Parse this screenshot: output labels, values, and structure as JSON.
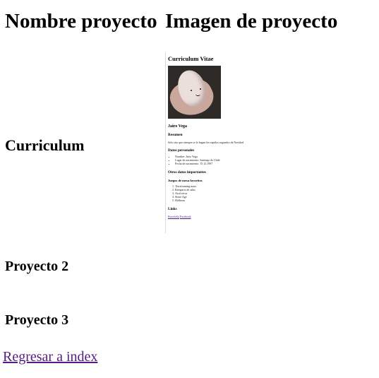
{
  "header": {
    "col_name": "Nombre proyecto",
    "col_image": "Imagen de proyecto"
  },
  "rows": [
    {
      "title": "Curriculum"
    },
    {
      "title": "Proyecto 2"
    },
    {
      "title": "Proyecto 3"
    }
  ],
  "cv_preview": {
    "title": "Curriculum Vitae",
    "name": "Jairo Vega",
    "summary_heading": "Resumen",
    "summary_text": "Solo sito que siempre se le hagan los rapidos segundos de Navidad y comas tantas, todo de abrazo.",
    "personal_heading": "Datos personales",
    "personal_items": [
      "Nombre: Jairo Vega",
      "Lugar de nacimiento: Santiago de Chile",
      "Fecha de nacimiento: 15.12.1997"
    ],
    "other_heading": "Otros datos importantes",
    "games_heading": "Juegos de mesa favoritos",
    "games_items": [
      "Terraforming mars",
      "Ramparts de sabu",
      "Azul cerca",
      "Stone Age",
      "Halleruu"
    ],
    "links_heading": "Links",
    "link_portfolio": "Portafolio",
    "link_facebook": "Facebook"
  },
  "footer": {
    "back_link": "Regresar a index"
  }
}
